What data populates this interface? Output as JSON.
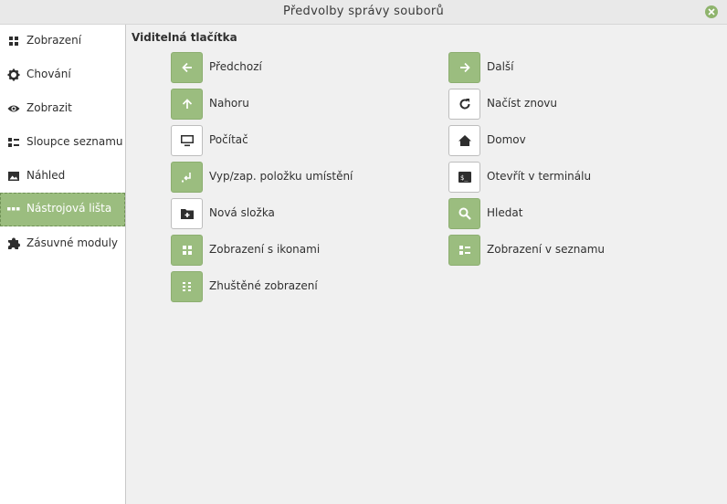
{
  "window": {
    "title": "Předvolby správy souborů"
  },
  "sidebar": {
    "items": [
      {
        "label": "Zobrazení",
        "icon": "grid-icon"
      },
      {
        "label": "Chování",
        "icon": "gear-icon"
      },
      {
        "label": "Zobrazit",
        "icon": "eye-icon"
      },
      {
        "label": "Sloupce seznamu",
        "icon": "list-columns-icon"
      },
      {
        "label": "Náhled",
        "icon": "image-icon"
      },
      {
        "label": "Nástrojová lišta",
        "icon": "toolbar-dots-icon",
        "active": true
      },
      {
        "label": "Zásuvné moduly",
        "icon": "puzzle-icon"
      }
    ]
  },
  "toolbar_section": {
    "title": "Viditelná tlačítka",
    "buttons": [
      {
        "label": "Předchozí",
        "icon": "arrow-left-icon",
        "enabled": true
      },
      {
        "label": "Další",
        "icon": "arrow-right-icon",
        "enabled": true
      },
      {
        "label": "Nahoru",
        "icon": "arrow-up-icon",
        "enabled": true
      },
      {
        "label": "Načíst znovu",
        "icon": "reload-icon",
        "enabled": false
      },
      {
        "label": "Počítač",
        "icon": "computer-icon",
        "enabled": false
      },
      {
        "label": "Domov",
        "icon": "home-icon",
        "enabled": false
      },
      {
        "label": "Vyp/zap. položku umístění",
        "icon": "location-toggle-icon",
        "enabled": true
      },
      {
        "label": "Otevřít v terminálu",
        "icon": "terminal-icon",
        "enabled": false
      },
      {
        "label": "Nová složka",
        "icon": "new-folder-icon",
        "enabled": false
      },
      {
        "label": "Hledat",
        "icon": "search-icon",
        "enabled": true
      },
      {
        "label": "Zobrazení s ikonami",
        "icon": "icon-view-icon",
        "enabled": true
      },
      {
        "label": "Zobrazení v seznamu",
        "icon": "list-view-icon",
        "enabled": true
      },
      {
        "label": "Zhuštěné zobrazení",
        "icon": "compact-view-icon",
        "enabled": true
      }
    ]
  },
  "colors": {
    "accent": "#9bbd7f",
    "close": "#8fb46d"
  }
}
